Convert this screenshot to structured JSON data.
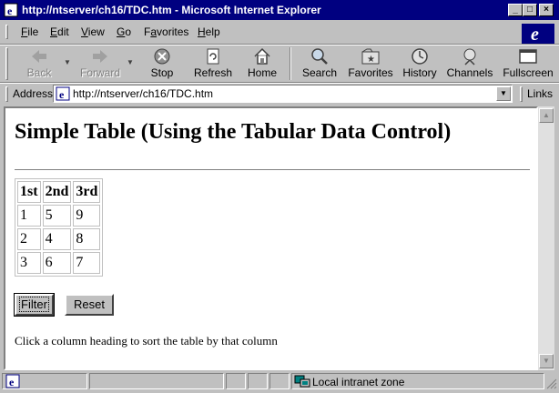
{
  "window": {
    "title": "http://ntserver/ch16/TDC.htm - Microsoft Internet Explorer"
  },
  "menu": {
    "items": [
      "File",
      "Edit",
      "View",
      "Go",
      "Favorites",
      "Help"
    ],
    "accel": [
      "F",
      "E",
      "V",
      "G",
      "a",
      "H"
    ]
  },
  "toolbar": {
    "back": "Back",
    "forward": "Forward",
    "stop": "Stop",
    "refresh": "Refresh",
    "home": "Home",
    "search": "Search",
    "favorites": "Favorites",
    "history": "History",
    "channels": "Channels",
    "fullscreen": "Fullscreen"
  },
  "address": {
    "label": "Address",
    "url": "http://ntserver/ch16/TDC.htm",
    "links": "Links"
  },
  "page": {
    "title": "Simple Table (Using the Tabular Data Control)",
    "table": {
      "headers": [
        "1st",
        "2nd",
        "3rd"
      ],
      "rows": [
        [
          "1",
          "5",
          "9"
        ],
        [
          "2",
          "4",
          "8"
        ],
        [
          "3",
          "6",
          "7"
        ]
      ]
    },
    "filter_button": "Filter",
    "reset_button": "Reset",
    "instruction": "Click a column heading to sort the table by that column"
  },
  "status": {
    "zone": "Local intranet zone"
  },
  "colors": {
    "titlebar": "#000080",
    "chrome": "#c0c0c0"
  }
}
